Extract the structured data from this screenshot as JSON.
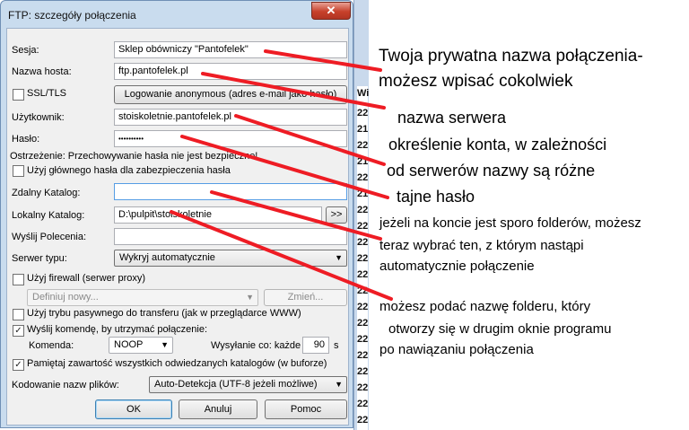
{
  "dialog": {
    "title": "FTP: szczegóły połączenia",
    "close_symbol": "✕",
    "session_label": "Sesja:",
    "session_value": "Sklep obówniczy \"Pantofelek\"",
    "host_label": "Nazwa hosta:",
    "host_value": "ftp.pantofelek.pl",
    "ssl_label": "SSL/TLS",
    "ssl_checked": false,
    "anon_button": "Logowanie anonymous (adres e-mail jako hasło)",
    "user_label": "Użytkownik:",
    "user_value": "stoiskoletnie.pantofelek.pl",
    "pass_label": "Hasło:",
    "pass_value": "••••••••••",
    "warning": "Ostrzeżenie: Przechowywanie hasła nie jest bezpieczne!",
    "master_label": "Użyj głównego hasła dla zabezpieczenia hasła",
    "remote_label": "Zdalny Katalog:",
    "remote_value": "",
    "local_label": "Lokalny Katalog:",
    "local_value": "D:\\pulpit\\stoiskoletnie",
    "browse_button": ">>",
    "send_label": "Wyślij Polecenia:",
    "send_value": "",
    "server_type_label": "Serwer typu:",
    "server_type_value": "Wykryj automatycznie",
    "firewall_label": "Użyj firewall (serwer proxy)",
    "firewall_select": "Definiuj nowy...",
    "change_button": "Zmień...",
    "passive_label": "Użyj trybu pasywnego do transferu (jak w przeglądarce WWW)",
    "keepalive_label": "Wyślij komendę, by utrzymać połączenie:",
    "command_label": "Komenda:",
    "command_value": "NOOP",
    "interval_label": "Wysyłanie co: każde",
    "interval_value": "90",
    "interval_unit": "s",
    "remember_label": "Pamiętaj zawartość wszystkich odwiedzanych katalogów (w buforze)",
    "encoding_label": "Kodowanie nazw plików:",
    "encoding_value": "Auto-Detekcja (UTF-8 jeżeli możliwe)",
    "ok_button": "OK",
    "cancel_button": "Anuluj",
    "help_button": "Pomoc"
  },
  "background": {
    "numbers": [
      "22",
      "21",
      "22",
      "21",
      "22",
      "21",
      "22",
      "22",
      "22",
      "22",
      "22",
      "22",
      "22",
      "22",
      "22",
      "22",
      "22",
      "22",
      "22",
      "22"
    ],
    "fragment": "Wi"
  },
  "annotations": {
    "a1_line1": "Twoja prywatna nazwa połączenia-",
    "a1_line2": "możesz wpisać cokolwiek",
    "a2": "nazwa serwera",
    "a3_line1": "określenie konta, w zależności",
    "a3_line2": "od serwerów nazwy są różne",
    "a4": "tajne hasło",
    "a5_line1": "jeżeli na koncie jest sporo folderów, możesz",
    "a5_line2": "teraz wybrać ten, z którym nastąpi",
    "a5_line3": "automatycznie połączenie",
    "a6_line1": "możesz podać nazwę folderu, który",
    "a6_line2": "otworzy się w drugim oknie programu",
    "a6_line3": "po nawiązaniu połączenia",
    "line_color": "#ee1c24"
  }
}
